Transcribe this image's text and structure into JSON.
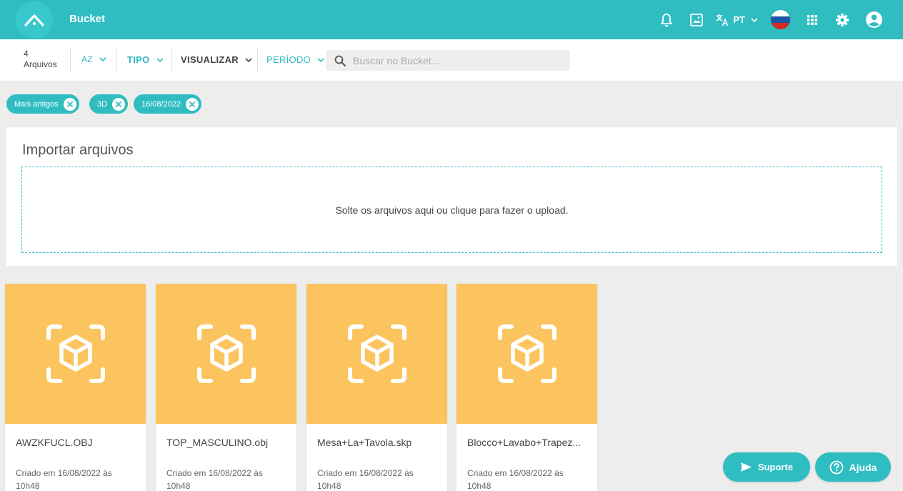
{
  "header": {
    "title": "Bucket",
    "language": "PT",
    "flag_colors": [
      "#ffffff",
      "#1c57a8",
      "#d52b1e"
    ],
    "accent": "#2fbdc2"
  },
  "filters": {
    "count_number": "4",
    "count_label": "Arquivos",
    "sort_label": "AZ",
    "type_label": "TIPO",
    "view_label": "VISUALIZAR",
    "period_label": "PERÍODO",
    "search_placeholder": "Buscar no Bucket..."
  },
  "chips": [
    {
      "label": "Mais antigos"
    },
    {
      "label": "3D"
    },
    {
      "label": "16/08/2022"
    }
  ],
  "upload": {
    "title": "Importar arquivos",
    "dropzone_text": "Solte os arquivos aqui ou clique para fazer o upload."
  },
  "files": [
    {
      "name": "AWZKFUCL.OBJ",
      "created": "Criado em 16/08/2022 às 10h48",
      "icon": "3d-cube-icon",
      "color": "#fcc45e"
    },
    {
      "name": "TOP_MASCULINO.obj",
      "created": "Criado em 16/08/2022 às 10h48",
      "icon": "3d-cube-icon",
      "color": "#fcc45e"
    },
    {
      "name": "Mesa+La+Tavola.skp",
      "created": "Criado em 16/08/2022 às 10h48",
      "icon": "3d-cube-icon",
      "color": "#fcc45e"
    },
    {
      "name": "Blocco+Lavabo+Trapez...",
      "created": "Criado em 16/08/2022 às 10h48",
      "icon": "3d-cube-icon",
      "color": "#fcc45e"
    }
  ],
  "actions": {
    "support_label": "Suporte",
    "help_label": "Ajuda"
  }
}
